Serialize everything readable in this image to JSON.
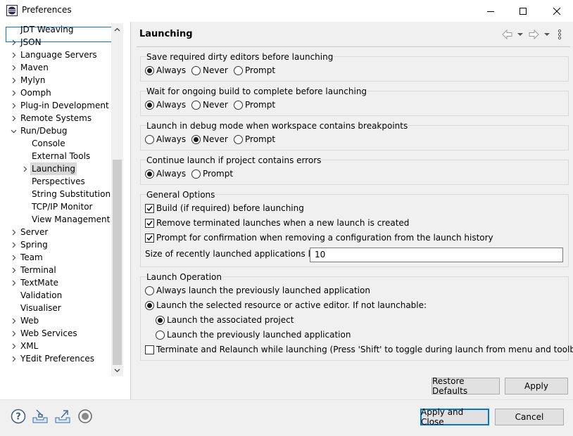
{
  "window": {
    "title": "Preferences"
  },
  "filter": {
    "value": ""
  },
  "tree": [
    {
      "label": "JDT Weaving",
      "expander": false
    },
    {
      "label": "JSON",
      "expander": true
    },
    {
      "label": "Language Servers",
      "expander": true
    },
    {
      "label": "Maven",
      "expander": true
    },
    {
      "label": "Mylyn",
      "expander": true
    },
    {
      "label": "Oomph",
      "expander": true
    },
    {
      "label": "Plug-in Development",
      "expander": true
    },
    {
      "label": "Remote Systems",
      "expander": true
    },
    {
      "label": "Run/Debug",
      "expander": "open"
    },
    {
      "label": "Console",
      "expander": false
    },
    {
      "label": "External Tools",
      "expander": false
    },
    {
      "label": "Launching",
      "expander": true
    },
    {
      "label": "Perspectives",
      "expander": false
    },
    {
      "label": "String Substitution",
      "expander": false
    },
    {
      "label": "TCP/IP Monitor",
      "expander": false
    },
    {
      "label": "View Management",
      "expander": false
    },
    {
      "label": "Server",
      "expander": true
    },
    {
      "label": "Spring",
      "expander": true
    },
    {
      "label": "Team",
      "expander": true
    },
    {
      "label": "Terminal",
      "expander": true
    },
    {
      "label": "TextMate",
      "expander": true
    },
    {
      "label": "Validation",
      "expander": false
    },
    {
      "label": "Visualiser",
      "expander": false
    },
    {
      "label": "Web",
      "expander": true
    },
    {
      "label": "Web Services",
      "expander": true
    },
    {
      "label": "XML",
      "expander": true
    },
    {
      "label": "YEdit Preferences",
      "expander": true
    }
  ],
  "page": {
    "title": "Launching"
  },
  "save_dirty": {
    "title": "Save required dirty editors before launching",
    "options": [
      "Always",
      "Never",
      "Prompt"
    ],
    "selected": "Always"
  },
  "wait_build": {
    "title": "Wait for ongoing build to complete before launching",
    "options": [
      "Always",
      "Never",
      "Prompt"
    ],
    "selected": "Always"
  },
  "debug_mode": {
    "title": "Launch in debug mode when workspace contains breakpoints",
    "options": [
      "Always",
      "Never",
      "Prompt"
    ],
    "selected": "Never"
  },
  "continue_errors": {
    "title": "Continue launch if project contains errors",
    "options": [
      "Always",
      "Prompt"
    ],
    "selected": "Always"
  },
  "general": {
    "title": "General Options",
    "build": {
      "label": "Build (if required) before launching",
      "checked": true
    },
    "remove_terminated": {
      "label": "Remove terminated launches when a new launch is created",
      "checked": true
    },
    "prompt_remove": {
      "label": "Prompt for confirmation when removing a configuration from the launch history",
      "checked": true
    },
    "size_label": "Size of recently launched applications list:",
    "size_value": "10"
  },
  "launch_op": {
    "title": "Launch Operation",
    "always_previous": "Always launch the previously launched application",
    "selected_resource": "Launch the selected resource or active editor. If not launchable:",
    "associated_project": "Launch the associated project",
    "previous_app": "Launch the previously launched application",
    "terminate_relaunch": "Terminate and Relaunch while launching (Press 'Shift' to toggle during launch from menu and toolbar)"
  },
  "buttons": {
    "restore_defaults": "Restore Defaults",
    "apply": "Apply",
    "apply_close": "Apply and Close",
    "cancel": "Cancel"
  },
  "colors": {
    "accent": "#0078d7",
    "selection": "#d9d9d9"
  }
}
